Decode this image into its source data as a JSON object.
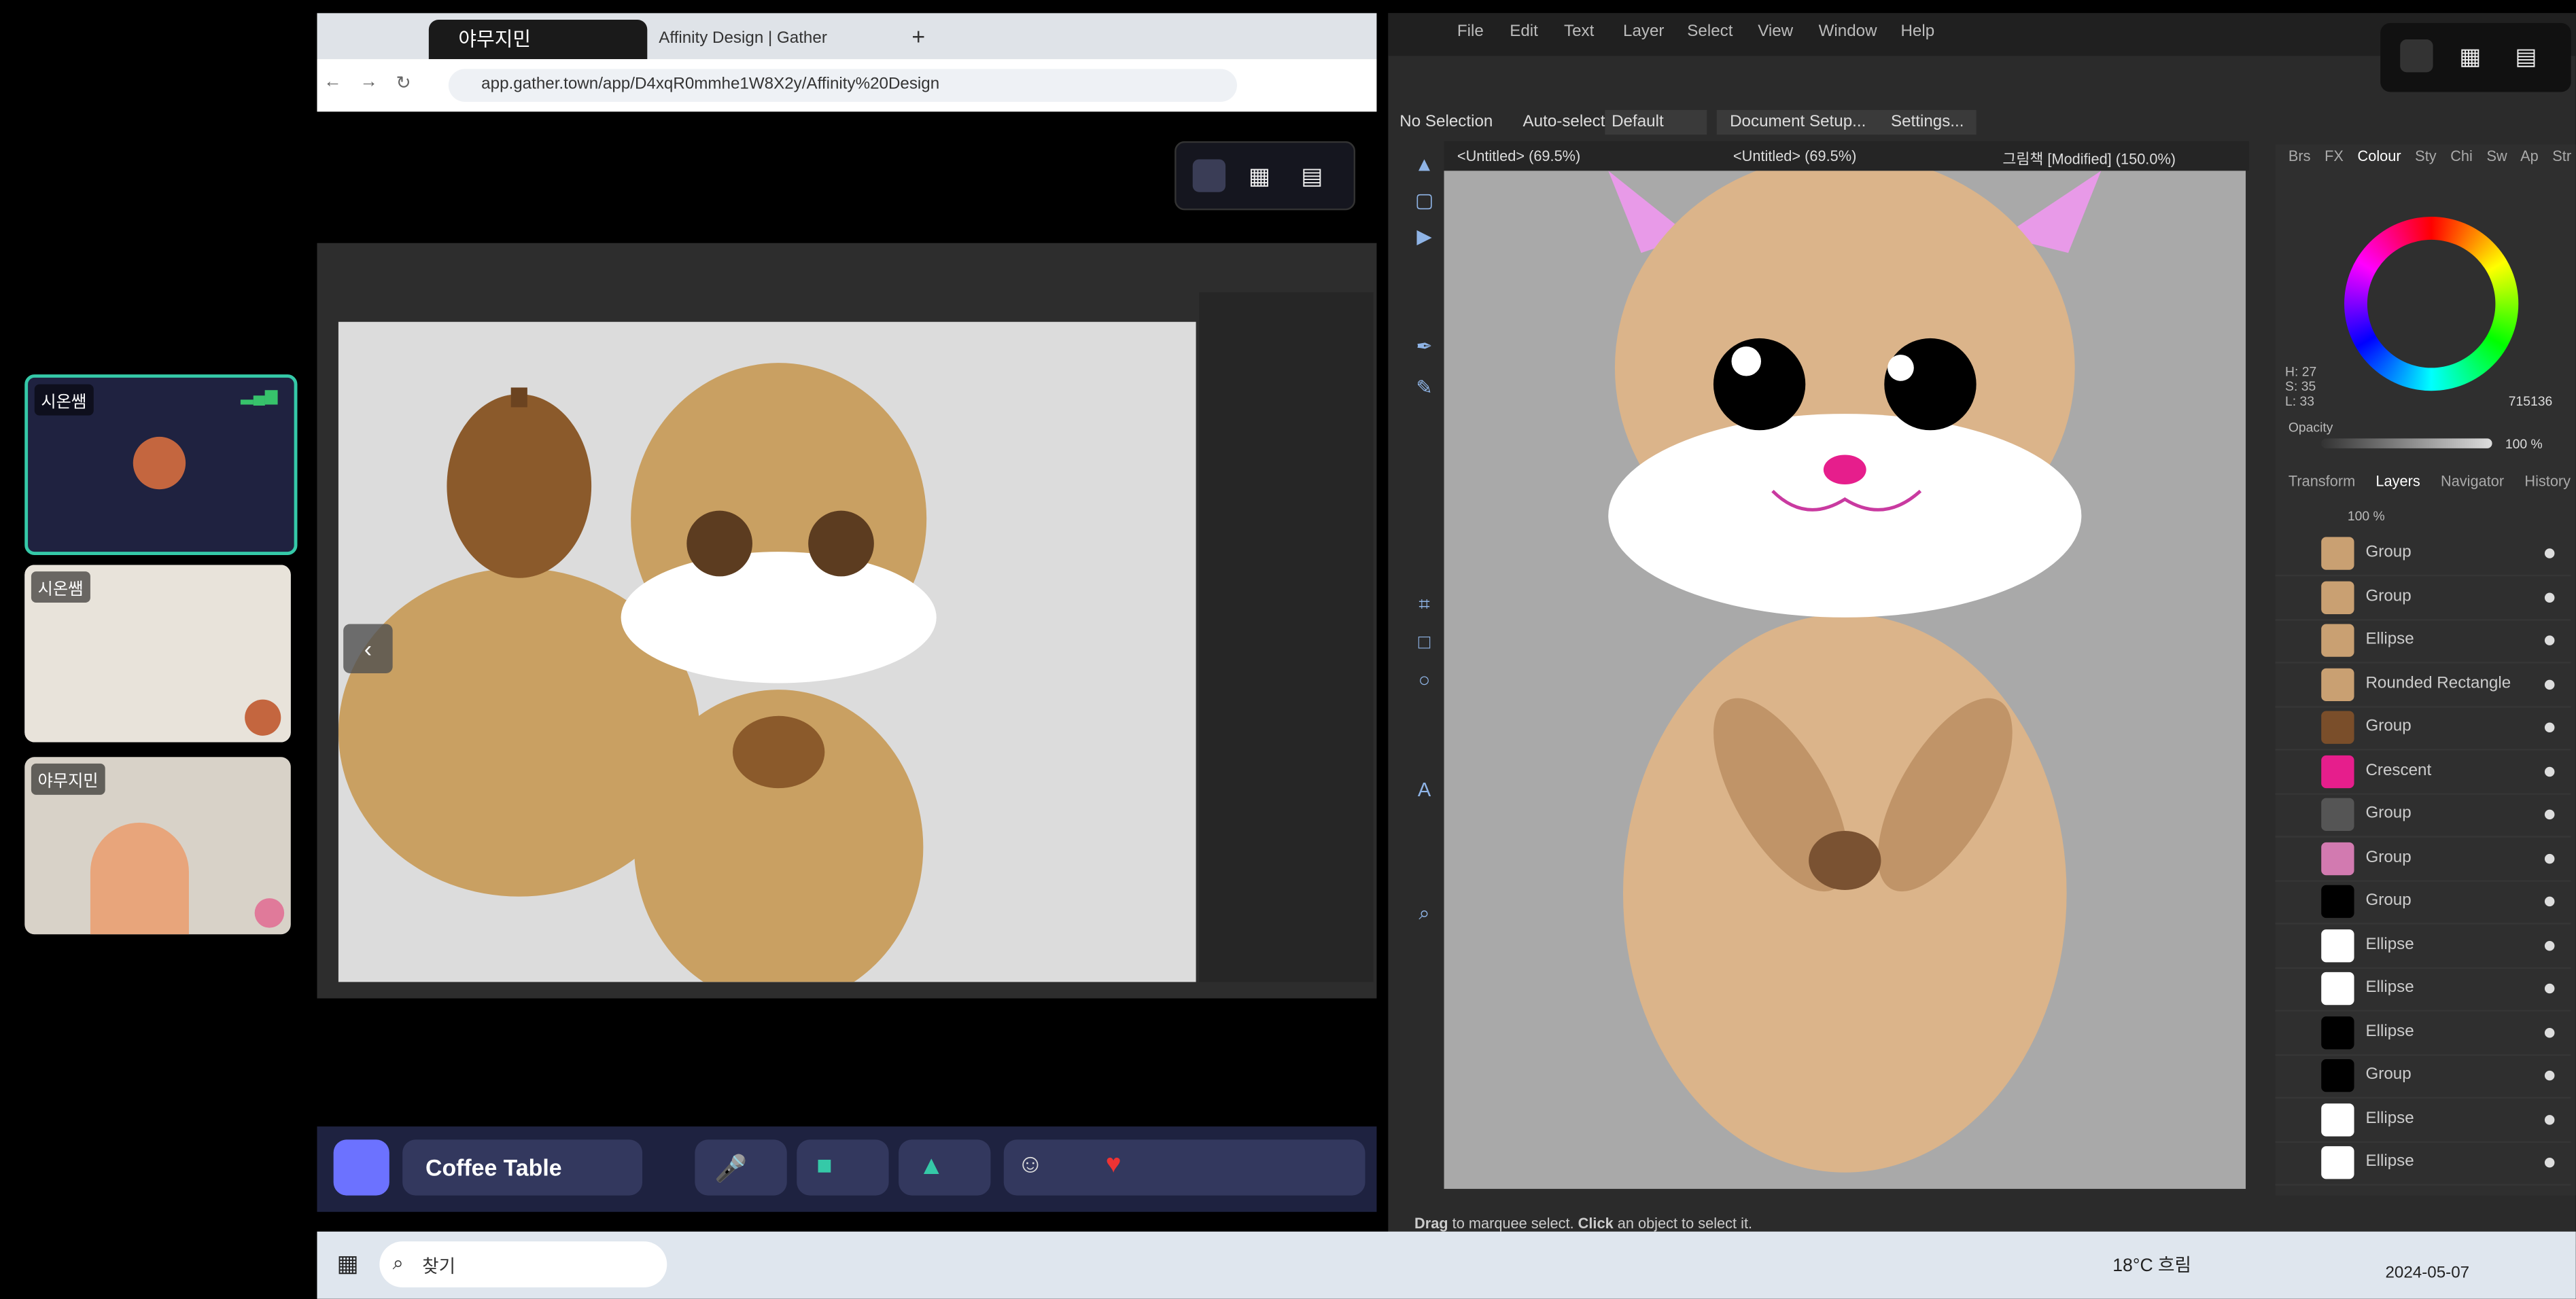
{
  "participants": [
    {
      "name": "시온쌤"
    },
    {
      "name": "시온쌤"
    },
    {
      "name": "야무지민"
    }
  ],
  "browser": {
    "tabs": [
      {
        "label": "야무지민"
      },
      {
        "label": "Affinity Design | Gather"
      }
    ],
    "url": "app.gather.town/app/D4xqR0mmhe1W8X2y/Affinity%20Design"
  },
  "gather": {
    "room_name": "Coffee Table"
  },
  "affinity": {
    "menu": [
      "File",
      "Edit",
      "Text",
      "Layer",
      "Select",
      "View",
      "Window",
      "Help"
    ],
    "context": {
      "selection": "No Selection",
      "auto_select": "Auto-select:",
      "auto_select_value": "Default",
      "document_setup": "Document Setup...",
      "settings": "Settings..."
    },
    "doc_tabs": [
      {
        "label": "<Untitled> (69.5%)"
      },
      {
        "label": "<Untitled> (69.5%)"
      },
      {
        "label": "그림책 [Modified] (150.0%)"
      }
    ],
    "panel_tabs": [
      "Brs",
      "FX",
      "Colour",
      "Sty",
      "Chi",
      "Sw",
      "Ap",
      "Str"
    ],
    "colour": {
      "h": "H: 27",
      "s": "S: 35",
      "l": "L: 33",
      "hex": "715136",
      "opacity_label": "Opacity",
      "opacity_value": "100 %"
    },
    "layers_tabs": [
      "Transform",
      "Layers",
      "Navigator",
      "History"
    ],
    "layers_opacity": "100 %",
    "layers": [
      {
        "name": "Group",
        "color": "#c9a072"
      },
      {
        "name": "Group",
        "color": "#c9a072"
      },
      {
        "name": "Ellipse",
        "color": "#c9a072"
      },
      {
        "name": "Rounded Rectangle",
        "color": "#c9a072"
      },
      {
        "name": "Group",
        "color": "#7a4e2a"
      },
      {
        "name": "Crescent",
        "color": "#e61e8c"
      },
      {
        "name": "Group",
        "color": "#555555"
      },
      {
        "name": "Group",
        "color": "#d27ab0"
      },
      {
        "name": "Group",
        "color": "#000000"
      },
      {
        "name": "Ellipse",
        "color": "#ffffff"
      },
      {
        "name": "Ellipse",
        "color": "#ffffff"
      },
      {
        "name": "Ellipse",
        "color": "#000000"
      },
      {
        "name": "Group",
        "color": "#000000"
      },
      {
        "name": "Ellipse",
        "color": "#ffffff"
      },
      {
        "name": "Ellipse",
        "color": "#ffffff"
      }
    ],
    "status": {
      "drag": "Drag",
      "to_marquee": " to marquee select. ",
      "click": "Click",
      "to_select": " an object to select it."
    }
  },
  "taskbar": {
    "search": "찾기",
    "weather": "18°C 흐림",
    "date": "2024-05-07"
  }
}
